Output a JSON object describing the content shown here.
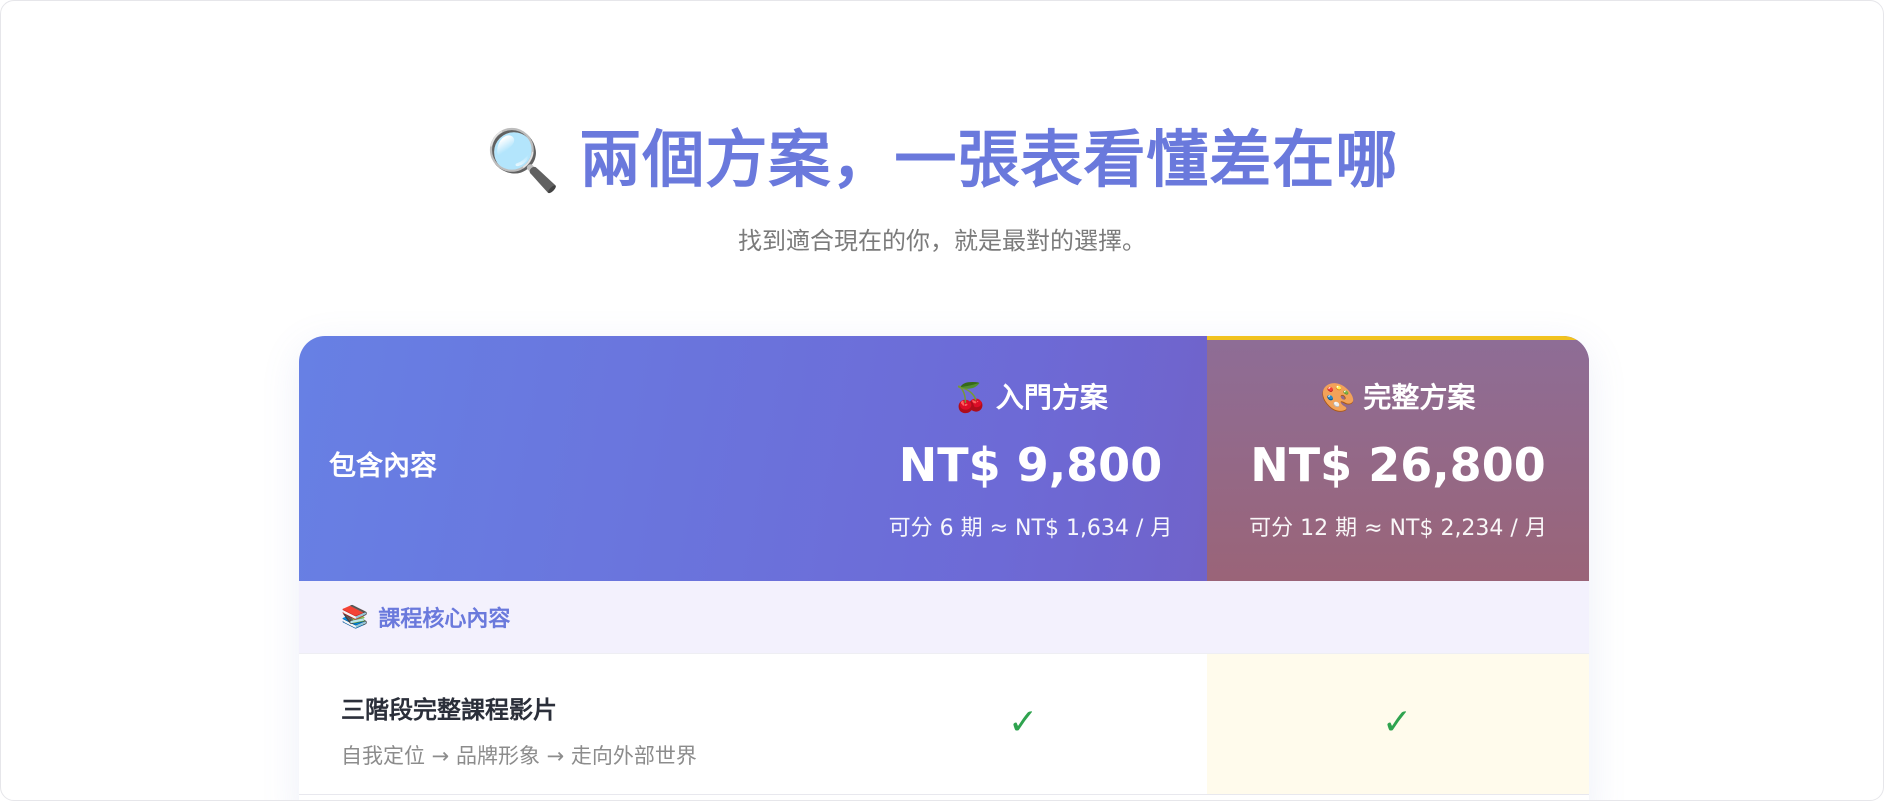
{
  "header": {
    "title_icon": "🔍",
    "title": "兩個方案，一張表看懂差在哪",
    "subtitle": "找到適合現在的你，就是最對的選擇。"
  },
  "table": {
    "label": "包含內容",
    "plans": [
      {
        "icon": "🍒",
        "name": "入門方案",
        "price": "NT$ 9,800",
        "installment": "可分 6 期 ≈ NT$ 1,634 / 月"
      },
      {
        "icon": "🎨",
        "name": "完整方案",
        "price": "NT$ 26,800",
        "installment": "可分 12 期 ≈ NT$ 2,234 / 月",
        "accent_color": "#f1c21f"
      }
    ],
    "sections": [
      {
        "icon": "📚",
        "title": "課程核心內容",
        "rows": [
          {
            "title": "三階段完整課程影片",
            "description": "自我定位 → 品牌形象 → 走向外部世界",
            "basic": "✓",
            "full": "✓"
          }
        ]
      }
    ]
  },
  "colors": {
    "brand": "#6a79dc",
    "check": "#2fa34f",
    "highlight": "#fffbec"
  }
}
